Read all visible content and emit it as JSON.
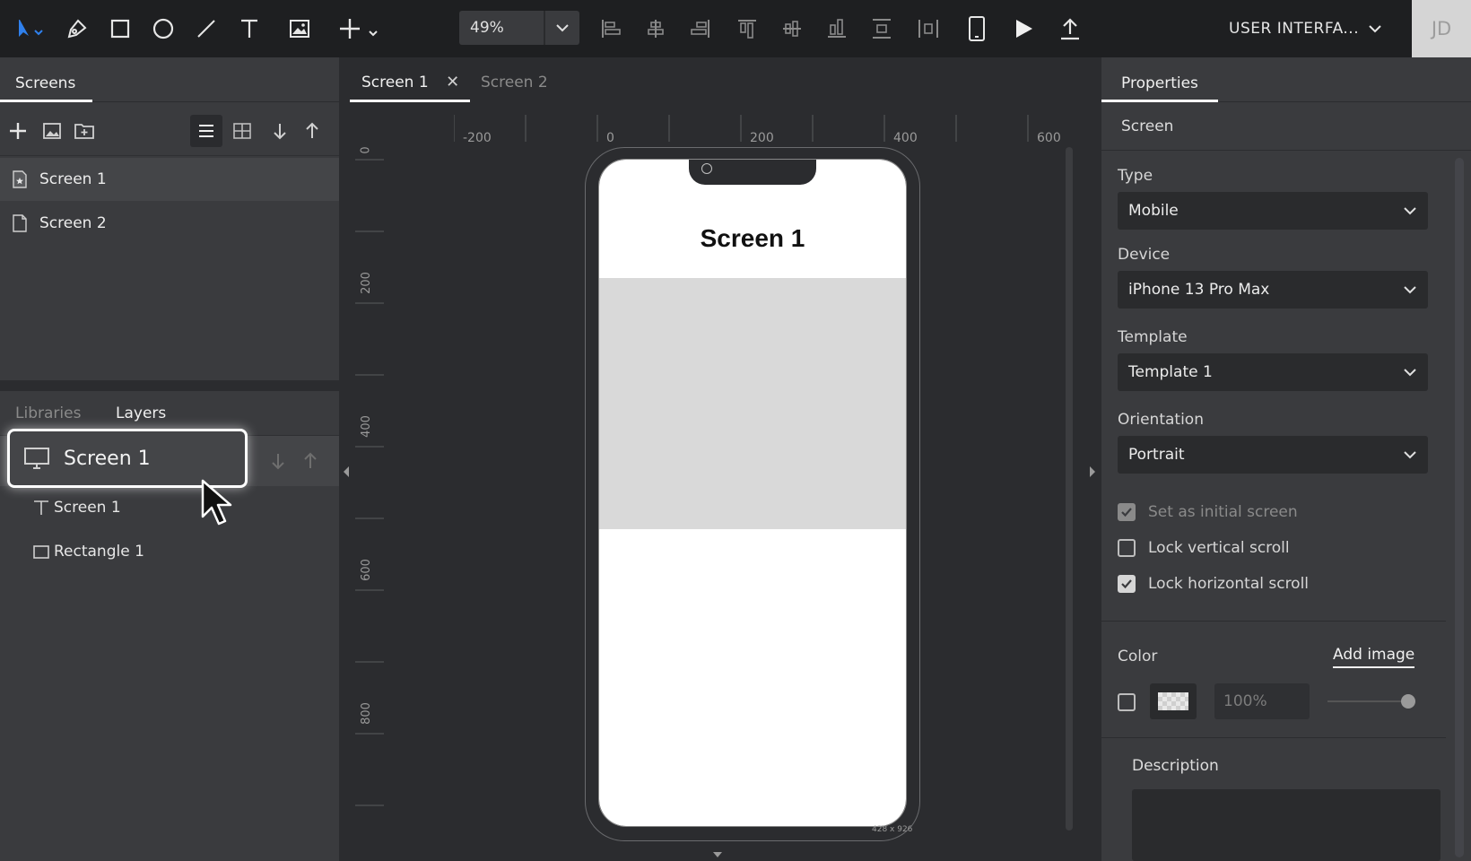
{
  "toolbar": {
    "tools": [
      "select-tool",
      "pen-tool",
      "rectangle-tool",
      "ellipse-tool",
      "line-tool",
      "text-tool",
      "image-tool",
      "add-tool"
    ],
    "zoom": "49%",
    "project_name": "USER INTERFA...",
    "avatar_initials": "JD",
    "accent": "#2f80ed"
  },
  "left_panel": {
    "tab": "Screens",
    "screens": [
      {
        "label": "Screen 1",
        "icon": "starred-page-icon"
      },
      {
        "label": "Screen 2",
        "icon": "page-icon"
      }
    ],
    "lower_tabs": {
      "libraries": "Libraries",
      "layers": "Layers"
    },
    "layers": {
      "root": "Screen 1",
      "children": [
        {
          "label": "Screen 1",
          "icon": "text-icon"
        },
        {
          "label": "Rectangle 1",
          "icon": "rectangle-icon"
        }
      ]
    }
  },
  "canvas": {
    "tabs": [
      {
        "label": "Screen 1",
        "active": true,
        "closable": true
      },
      {
        "label": "Screen 2",
        "active": false
      }
    ],
    "ruler_h": [
      "-200",
      "0",
      "200",
      "400",
      "600"
    ],
    "ruler_v": [
      "0",
      "200",
      "400",
      "600",
      "800"
    ],
    "phone_title": "Screen 1",
    "dimensions": "428 x 926"
  },
  "right_panel": {
    "tab": "Properties",
    "section": "Screen",
    "type_label": "Type",
    "type_value": "Mobile",
    "device_label": "Device",
    "device_value": "iPhone 13 Pro Max",
    "template_label": "Template",
    "template_value": "Template 1",
    "orientation_label": "Orientation",
    "orientation_value": "Portrait",
    "checks": [
      {
        "label": "Set as initial screen",
        "checked": true,
        "disabled": true
      },
      {
        "label": "Lock vertical scroll",
        "checked": false
      },
      {
        "label": "Lock horizontal scroll",
        "checked": true
      }
    ],
    "color_label": "Color",
    "add_image": "Add image",
    "opacity": "100%",
    "description_label": "Description"
  }
}
